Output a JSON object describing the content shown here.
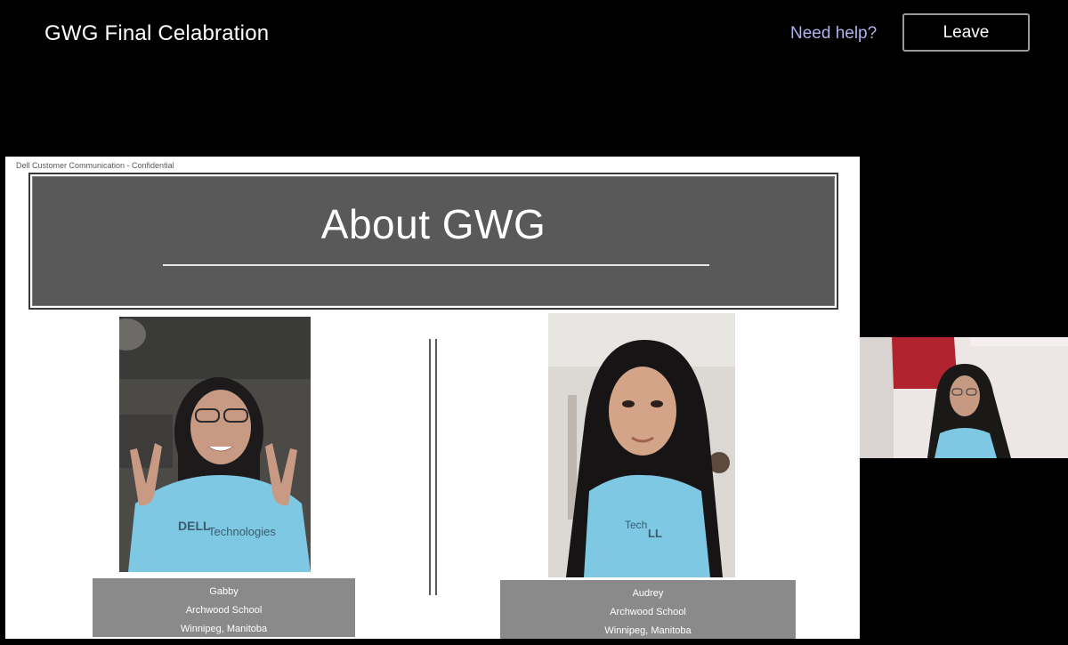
{
  "header": {
    "meeting_title": "GWG Final Celabration",
    "help_label": "Need help?",
    "leave_label": "Leave"
  },
  "slide": {
    "confidential_note": "Dell Customer Communication - Confidential",
    "title": "About GWG",
    "people": [
      {
        "name": "Gabby",
        "school": "Archwood School",
        "location": "Winnipeg, Manitoba"
      },
      {
        "name": "Audrey",
        "school": "Archwood School",
        "location": "Winnipeg, Manitoba"
      }
    ]
  },
  "colors": {
    "background": "#000000",
    "help_link": "#b3b0f0",
    "title_bar": "#595959",
    "caption_bar": "#8a8a8a",
    "shirt_blue": "#7ec8e3"
  }
}
